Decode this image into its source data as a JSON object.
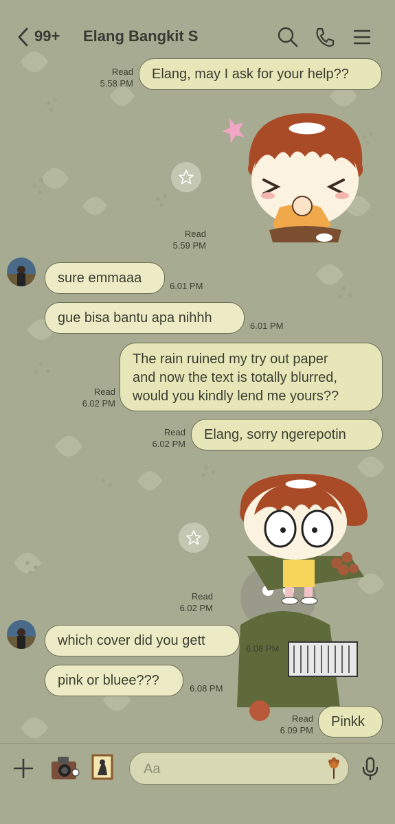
{
  "header": {
    "unread_count": "99+",
    "chat_title": "Elang Bangkit S"
  },
  "messages": [
    {
      "direction": "outgoing",
      "text": "Elang, may I ask for your help??",
      "read_label": "Read",
      "time": "5.58 PM"
    },
    {
      "direction": "outgoing",
      "type": "sticker",
      "read_label": "Read",
      "time": "5.59 PM"
    },
    {
      "direction": "incoming",
      "text": "sure emmaaa",
      "time": "6.01 PM"
    },
    {
      "direction": "incoming",
      "text": "gue bisa bantu apa nihhh",
      "time": "6.01 PM"
    },
    {
      "direction": "outgoing",
      "lines": [
        "The rain ruined my try out paper",
        "and now the text is totally blurred,",
        "would you kindly lend me yours??"
      ],
      "read_label": "Read",
      "time": "6.02 PM"
    },
    {
      "direction": "outgoing",
      "text": "Elang, sorry ngerepotin",
      "read_label": "Read",
      "time": "6.02 PM"
    },
    {
      "direction": "outgoing",
      "type": "sticker",
      "read_label": "Read",
      "time": "6.02 PM"
    },
    {
      "direction": "incoming",
      "text": "which cover did you gett",
      "time": "6.08 PM"
    },
    {
      "direction": "incoming",
      "text": "pink or bluee???",
      "time": "6.08 PM"
    },
    {
      "direction": "outgoing",
      "text": "Pinkk",
      "read_label": "Read",
      "time": "6.09 PM"
    }
  ],
  "input": {
    "placeholder": "Aa"
  },
  "icons": {
    "back": "chevron-left-icon",
    "search": "search-icon",
    "call": "phone-icon",
    "menu": "menu-icon",
    "add": "plus-icon",
    "camera": "camera-icon",
    "gallery": "gallery-icon",
    "emoji": "sticker-icon",
    "voice": "microphone-icon",
    "favorite": "star-icon"
  },
  "colors": {
    "background": "#a6ab91",
    "bubble": "#ecebc6",
    "bubble_border": "#6a6d55",
    "text": "#3c3f30"
  }
}
